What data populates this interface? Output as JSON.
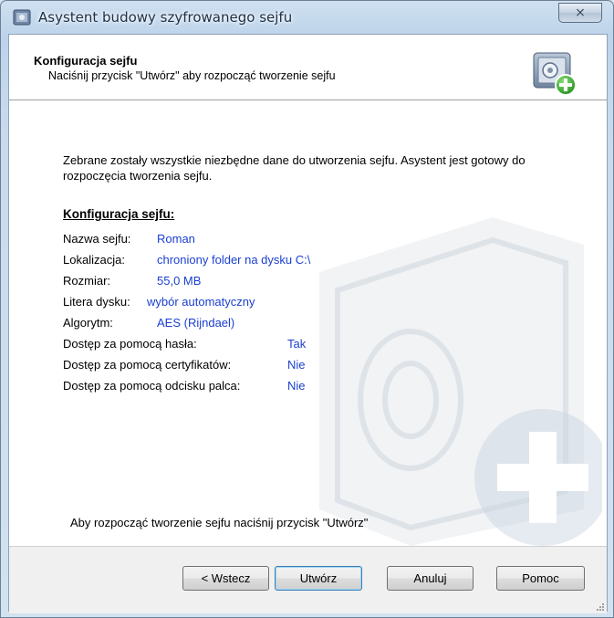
{
  "window": {
    "title": "Asystent budowy szyfrowanego sejfu",
    "close_label": "⨯"
  },
  "header": {
    "title": "Konfiguracja sejfu",
    "subtitle": "Naciśnij przycisk \"Utwórz\" aby rozpocząć tworzenie sejfu"
  },
  "body": {
    "intro": "Zebrane zostały wszystkie niezbędne dane do utworzenia sejfu. Asystent jest gotowy do rozpoczęcia tworzenia sejfu.",
    "section_title": "Konfiguracja sejfu:",
    "config": [
      {
        "label": "Nazwa sejfu:",
        "value": "Roman"
      },
      {
        "label": "Lokalizacja:",
        "value": "chroniony folder na dysku C:\\"
      },
      {
        "label": "Rozmiar:",
        "value": "55,0 MB"
      },
      {
        "label": "Litera dysku:",
        "value": "wybór automatyczny"
      },
      {
        "label": "Algorytm:",
        "value": "AES (Rijndael)"
      },
      {
        "label": "Dostęp za pomocą hasła:",
        "value": "Tak"
      },
      {
        "label": "Dostęp za pomocą certyfikatów:",
        "value": "Nie"
      },
      {
        "label": "Dostęp za pomocą odcisku palca:",
        "value": "Nie"
      }
    ],
    "footer_text": "Aby rozpocząć tworzenie sejfu naciśnij przycisk \"Utwórz\""
  },
  "buttons": {
    "back": "< Wstecz",
    "create": "Utwórz",
    "cancel": "Anuluj",
    "help": "Pomoc"
  },
  "colors": {
    "value_text": "#1a3fd0",
    "window_frame": "#c7d9ec"
  }
}
